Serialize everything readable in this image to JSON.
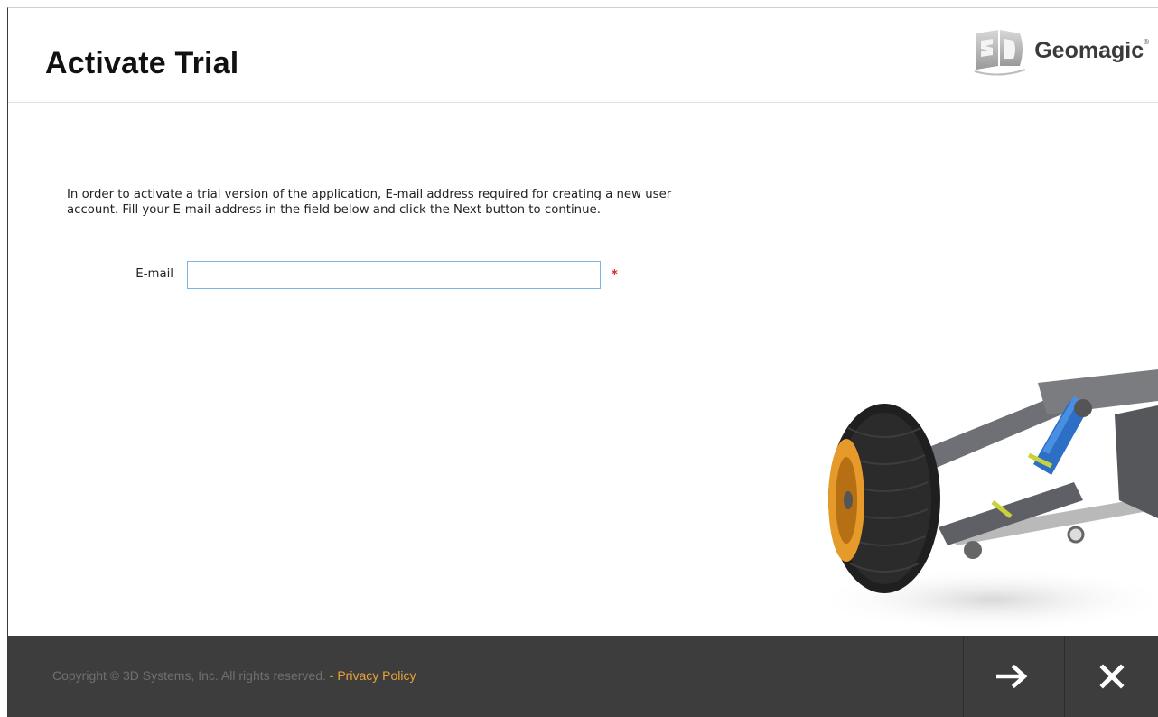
{
  "header": {
    "title": "Activate Trial",
    "brand": "Geomagic",
    "brand_mark": "®"
  },
  "form": {
    "instructions": "In order to activate a trial version of the application, E-mail address required for creating a new user account. Fill your E-mail address in the field below and click the Next button to continue.",
    "email_label": "E-mail",
    "email_value": "",
    "required_mark": "*"
  },
  "footer": {
    "copyright": "Copyright © 3D Systems, Inc. All rights reserved.",
    "separator": " - ",
    "privacy_link": "Privacy Policy",
    "next_icon": "arrow-right-icon",
    "close_icon": "close-icon"
  },
  "colors": {
    "footer_bg": "#3d3d3d",
    "privacy_link": "#e8a33a",
    "input_border": "#7eb4e2",
    "required": "#dd2222"
  }
}
